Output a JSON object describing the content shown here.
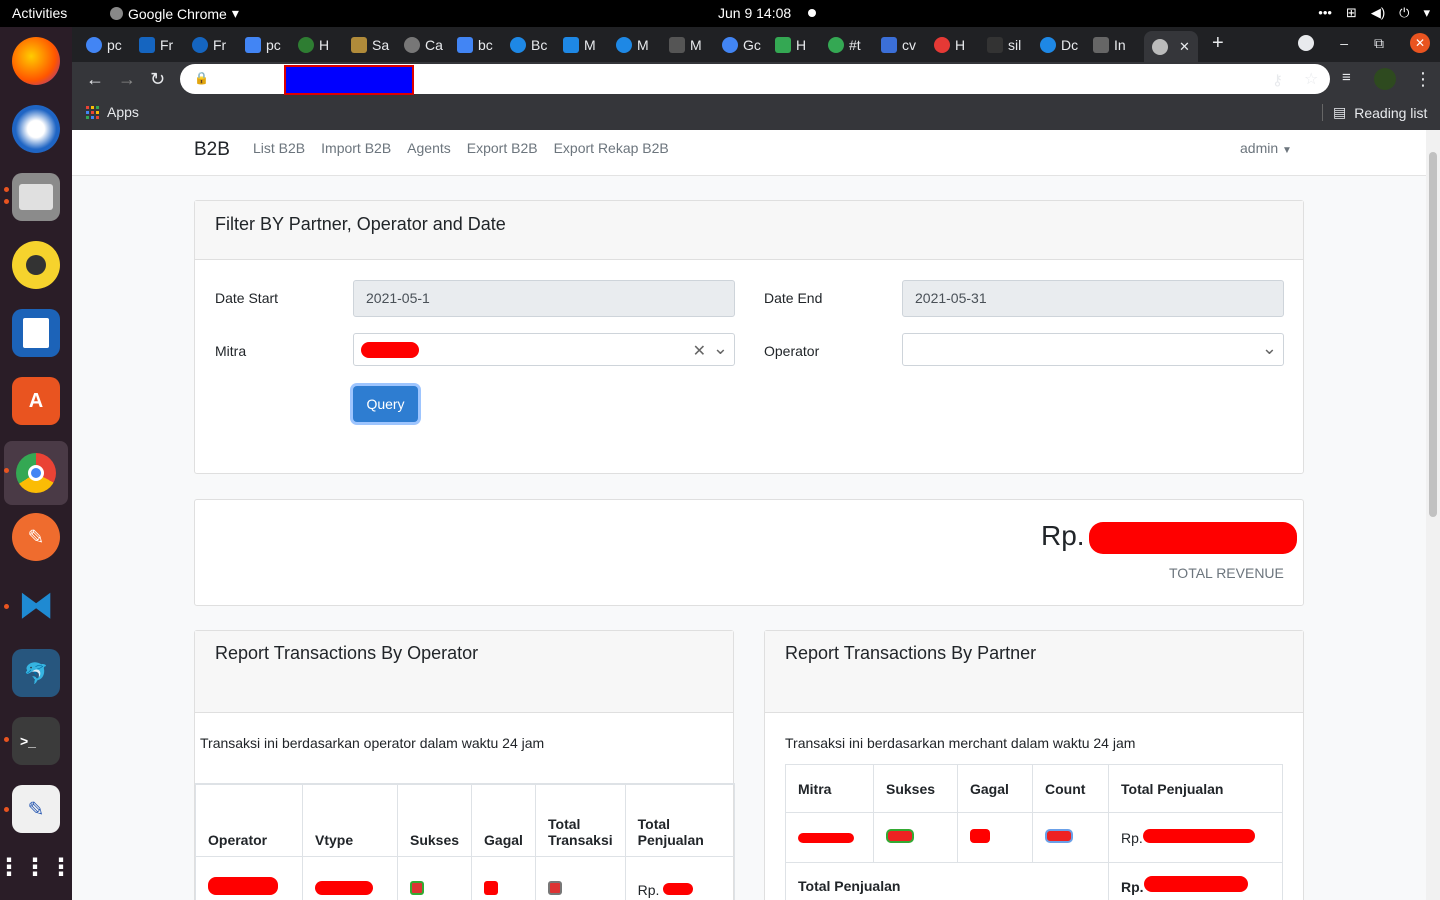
{
  "system": {
    "activities": "Activities",
    "app_name": "Google Chrome",
    "clock": "Jun 9  14:08"
  },
  "browser": {
    "tabs": [
      "pc",
      "Fr",
      "Fr",
      "pc",
      "H",
      "Sa",
      "Ca",
      "bc",
      "Bc",
      "M",
      "M",
      "M",
      "Gc",
      "H",
      "#t",
      "cv",
      "H",
      "sil",
      "Dc",
      "In"
    ],
    "bookmarks_apps": "Apps",
    "reading_list": "Reading list"
  },
  "app": {
    "brand": "B2B",
    "nav": [
      "List B2B",
      "Import B2B",
      "Agents",
      "Export B2B",
      "Export Rekap B2B"
    ],
    "user": "admin"
  },
  "filter": {
    "title": "Filter BY Partner, Operator and Date",
    "date_start_label": "Date Start",
    "date_start_value": "2021-05-1",
    "date_end_label": "Date End",
    "date_end_value": "2021-05-31",
    "mitra_label": "Mitra",
    "operator_label": "Operator",
    "query_button": "Query"
  },
  "revenue": {
    "prefix": "Rp.",
    "caption": "TOTAL REVENUE"
  },
  "operator_report": {
    "title": "Report Transactions By Operator",
    "note": "Transaksi ini berdasarkan operator dalam waktu 24 jam",
    "headers": [
      "Operator",
      "Vtype",
      "Sukses",
      "Gagal",
      "Total Transaksi",
      "Total Penjualan"
    ],
    "rp": "Rp."
  },
  "partner_report": {
    "title": "Report Transactions By Partner",
    "note": "Transaksi ini berdasarkan merchant dalam waktu 24 jam",
    "headers": [
      "Mitra",
      "Sukses",
      "Gagal",
      "Count",
      "Total Penjualan"
    ],
    "rp": "Rp.",
    "total_label": "Total Penjualan",
    "total_rp": "Rp."
  }
}
